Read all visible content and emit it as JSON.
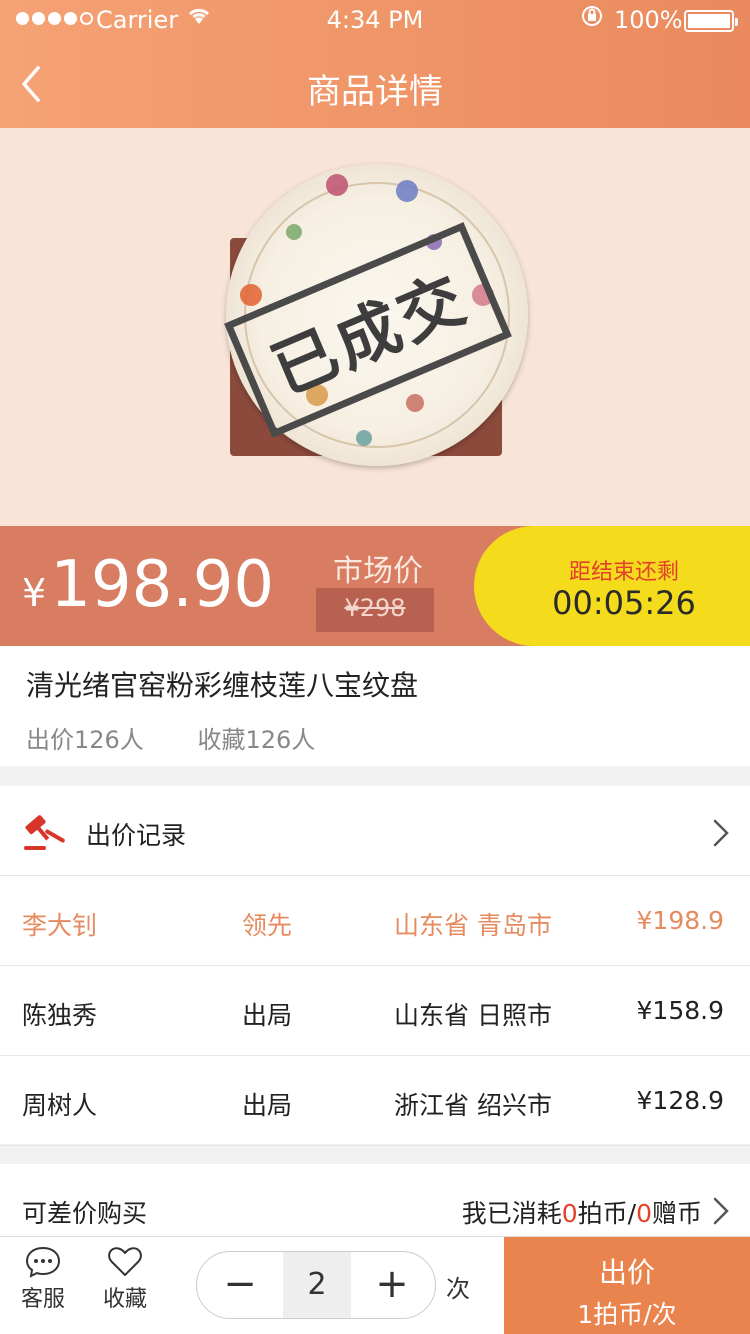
{
  "status_bar": {
    "carrier": "Carrier",
    "time": "4:34 PM",
    "battery": "100%"
  },
  "nav": {
    "title": "商品详情"
  },
  "product": {
    "stamp": "已成交",
    "price_symbol": "¥",
    "price": "198.90",
    "market_label": "市场价",
    "market_price": "¥298",
    "countdown_label": "距结束还剩",
    "countdown": "00:05:26",
    "title": "清光绪官窑粉彩缠枝莲八宝纹盘",
    "bids_count": "出价126人",
    "favorites_count": "收藏126人"
  },
  "bid_record": {
    "title": "出价记录",
    "rows": [
      {
        "name": "李大钊",
        "status": "领先",
        "location": "山东省 青岛市",
        "amount": "¥198.9"
      },
      {
        "name": "陈独秀",
        "status": "出局",
        "location": "山东省 日照市",
        "amount": "¥158.9"
      },
      {
        "name": "周树人",
        "status": "出局",
        "location": "浙江省 绍兴市",
        "amount": "¥128.9"
      }
    ]
  },
  "diff_buy": {
    "label": "可差价购买",
    "prefix": "我已消耗",
    "coins": "0",
    "mid": "拍币/",
    "gifts": "0",
    "suffix": "赠币"
  },
  "bottom_bar": {
    "service": "客服",
    "favorite": "收藏",
    "minus": "−",
    "quantity": "2",
    "plus": "+",
    "unit": "次",
    "bid_label": "出价",
    "bid_cost": "1拍币/次"
  },
  "colors": {
    "accent": "#e9844f",
    "price_bg": "#d87d62",
    "timer_bg": "#f4dc1c",
    "lead": "#e68b5f"
  }
}
